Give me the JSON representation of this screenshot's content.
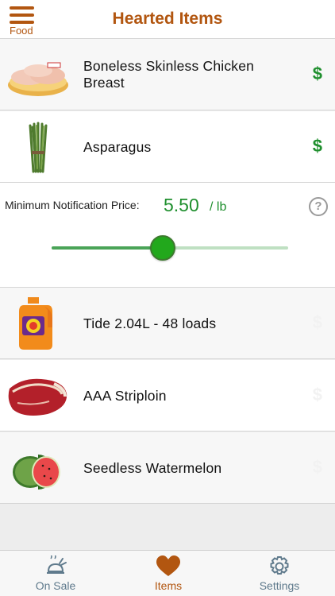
{
  "header": {
    "menu_label": "Food",
    "title": "Hearted Items"
  },
  "items": [
    {
      "name": "Boneless Skinless Chicken Breast",
      "price_icon": "$",
      "alert_active": true,
      "thumb": "chicken-breast-image"
    },
    {
      "name": "Asparagus",
      "price_icon": "$",
      "alert_active": true,
      "thumb": "asparagus-image"
    },
    {
      "name": "Tide 2.04L - 48 loads",
      "price_icon": "$",
      "alert_active": false,
      "thumb": "tide-detergent-image"
    },
    {
      "name": "AAA Striploin",
      "price_icon": "$",
      "alert_active": false,
      "thumb": "striploin-steak-image"
    },
    {
      "name": "Seedless Watermelon",
      "price_icon": "$",
      "alert_active": false,
      "thumb": "watermelon-image"
    }
  ],
  "notification": {
    "label": "Minimum Notification Price:",
    "value": "5.50",
    "unit": "/ lb",
    "help_icon": "?",
    "slider_fraction": 0.47
  },
  "tabbar": {
    "tabs": [
      {
        "label": "On Sale",
        "icon": "turkey-sale-icon",
        "selected": false
      },
      {
        "label": "Items",
        "icon": "heart-icon",
        "selected": true
      },
      {
        "label": "Settings",
        "icon": "gear-icon",
        "selected": false
      }
    ]
  },
  "colors": {
    "brand": "#b25610",
    "price_active": "#1f8f2e",
    "price_inactive": "#f2f2f2",
    "tab_inactive": "#5f7a8c"
  }
}
